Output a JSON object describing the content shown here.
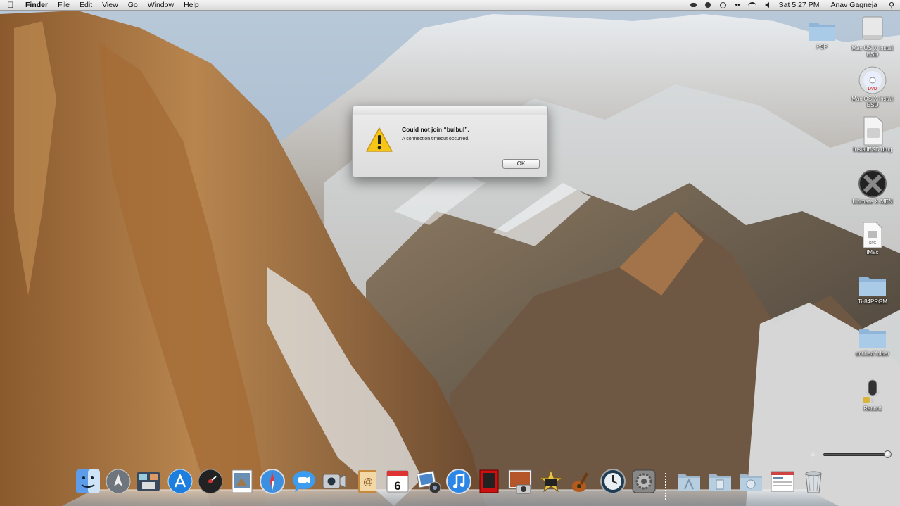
{
  "menubar": {
    "apple_icon": "apple-icon",
    "app_name": "Finder",
    "menus": [
      "File",
      "Edit",
      "View",
      "Go",
      "Window",
      "Help"
    ],
    "status_icons": [
      "airplay-icon",
      "backup-icon",
      "time-machine-icon",
      "bluetooth-icon",
      "wifi-icon",
      "volume-icon"
    ],
    "clock": "Sat 5:27 PM",
    "user": "Anav Gagneja",
    "spotlight_icon": "spotlight-search-icon"
  },
  "alert": {
    "icon": "caution-icon",
    "headline": "Could not join “bulbul”.",
    "message": "A connection timeout occurred.",
    "ok_label": "OK"
  },
  "desktop_icons": [
    {
      "label": "PSP",
      "icon": "folder-icon"
    },
    {
      "label": "Mac OS X Install ESD",
      "icon": "drive-icon"
    },
    {
      "label": "Mac OS X Install ESD",
      "icon": "dvd-icon"
    },
    {
      "label": "InstallESD.dmg",
      "icon": "disk-image-icon"
    },
    {
      "label": "Ultimate X-MEN",
      "icon": "xmen-icon"
    },
    {
      "label": "iMac",
      "icon": "document-icon"
    },
    {
      "label": "Ti-84PRGM",
      "icon": "folder-icon"
    },
    {
      "label": "untitled folder",
      "icon": "folder-icon"
    },
    {
      "label": "Record",
      "icon": "microphone-icon"
    }
  ],
  "dock": {
    "items": [
      "finder-icon",
      "launchpad-icon",
      "mission-control-icon",
      "app-store-icon",
      "dashboard-icon",
      "preview-icon",
      "safari-icon",
      "messages-icon",
      "facetime-icon",
      "address-book-icon",
      "calendar-icon",
      "iphoto-icon",
      "itunes-icon",
      "photo-booth-icon",
      "image-capture-icon",
      "imovie-icon",
      "garageband-icon",
      "time-machine-icon",
      "system-preferences-icon",
      "applications-stack-icon",
      "documents-stack-icon",
      "downloads-stack-icon",
      "web-clip-icon",
      "trash-icon"
    ],
    "calendar_day": "6"
  },
  "brightness": {
    "level": 0.95
  }
}
